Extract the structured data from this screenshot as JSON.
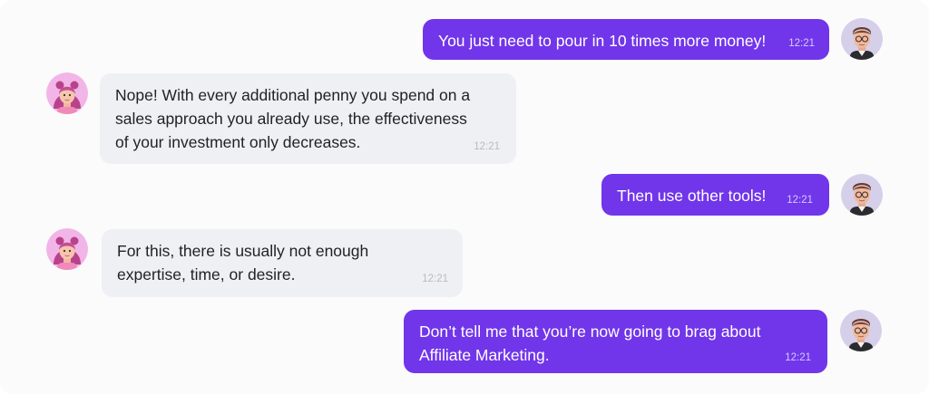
{
  "messages": [
    {
      "sender": "man",
      "text": "You just need to pour in 10 times more money!",
      "time": "12:21"
    },
    {
      "sender": "woman",
      "text": "Nope! With every additional penny you spend on a\nsales approach you already use, the effectiveness\nof your investment only decreases.",
      "time": "12:21"
    },
    {
      "sender": "man",
      "text": "Then use other tools!",
      "time": "12:21"
    },
    {
      "sender": "woman",
      "text": "For this, there is usually not enough\nexpertise, time, or desire.",
      "time": "12:21"
    },
    {
      "sender": "man",
      "text": "Don’t tell me that you’re now going to brag about\nAffiliate Marketing.",
      "time": "12:21"
    }
  ],
  "colors": {
    "outgoing_bubble": "#7135ea",
    "incoming_bubble": "#eef0f3",
    "woman_avatar_bg": "#f2b5e8",
    "man_avatar_bg": "#d6cfe9"
  },
  "icons": {
    "woman": "woman-avatar-icon",
    "man": "man-avatar-icon"
  }
}
